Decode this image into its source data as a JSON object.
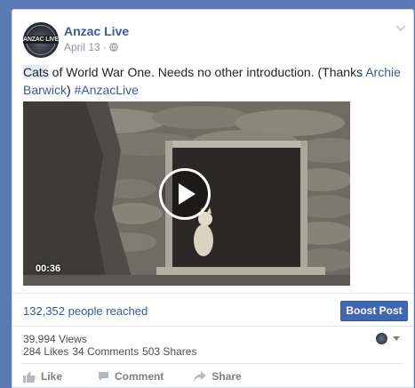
{
  "post": {
    "page_name": "Anzac Live",
    "date": "April 13 ·",
    "avatar_text": "ANZAC LIVE",
    "caption_highlight": "Cats",
    "caption_text": " of World War One. Needs no other introduction. (Thanks ",
    "caption_mention": "Archie Barwick",
    "caption_close": ") ",
    "caption_hashtag": "#AnzacLive"
  },
  "video": {
    "duration": "00:36"
  },
  "insights": {
    "reach_text": "132,352 people reached",
    "boost_label": "Boost Post",
    "views": "39,994 Views",
    "likes": "284 Likes",
    "comments": "34 Comments",
    "shares": "503 Shares"
  },
  "actions": {
    "like_label": "Like",
    "comment_label": "Comment",
    "share_label": "Share"
  },
  "icons": {
    "globe": "globe-icon",
    "chevron": "chevron-down-icon",
    "play": "play-icon",
    "like": "thumbs-up-icon",
    "comment": "comment-icon",
    "share": "share-arrow-icon"
  },
  "colors": {
    "link": "#3b5998",
    "boost_button": "#4267b2",
    "background": "#5b7ab5"
  }
}
